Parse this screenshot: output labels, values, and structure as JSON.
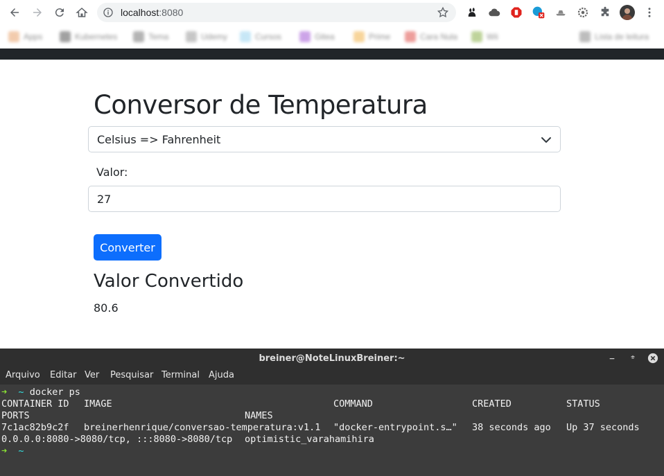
{
  "browser": {
    "url_host": "localhost",
    "url_port": ":8080",
    "bookmarks": [
      "Apps",
      "Kubernetes",
      "Tema",
      "Udemy",
      "Cursos",
      "Gitea",
      "Prime",
      "Cara Nula",
      "Wii",
      "Lista de leitura"
    ]
  },
  "page": {
    "title": "Conversor de Temperatura",
    "select_value": "Celsius => Fahrenheit",
    "value_label": "Valor:",
    "value_input": "27",
    "convert_button": "Converter",
    "result_title": "Valor Convertido",
    "result_value": "80.6"
  },
  "terminal": {
    "title": "breiner@NoteLinuxBreiner:~",
    "menu": [
      "Arquivo",
      "Editar",
      "Ver",
      "Pesquisar",
      "Terminal",
      "Ajuda"
    ],
    "prompt_arrow": "➜",
    "prompt_dir": "~",
    "command": "docker ps",
    "headers": {
      "container_id": "CONTAINER ID",
      "image": "IMAGE",
      "command": "COMMAND",
      "created": "CREATED",
      "status": "STATUS",
      "ports": "PORTS",
      "names": "NAMES"
    },
    "row": {
      "container_id": "7c1ac82b9c2f",
      "image": "breinerhenrique/conversao-temperatura:v1.1",
      "command": "\"docker-entrypoint.s…\"",
      "created": "38 seconds ago",
      "status": "Up 37 seconds",
      "ports": "0.0.0.0:8080->8080/tcp, :::8080->8080/tcp",
      "names": "optimistic_varahamihira"
    }
  },
  "colors": {
    "primary_button": "#0d6efd",
    "navbar": "#212529",
    "terminal_bg": "#3c3c3c",
    "prompt_arrow": "#8ae234",
    "prompt_dir": "#34e2e2"
  }
}
